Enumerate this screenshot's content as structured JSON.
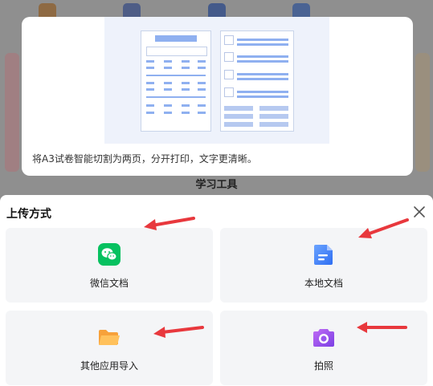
{
  "tip": {
    "description": "将A3试卷智能切割为两页，分开打印，文字更清晰。"
  },
  "background": {
    "section_title": "学习工具"
  },
  "upload_sheet": {
    "title": "上传方式",
    "options": [
      {
        "label": "微信文档",
        "icon": "wechat-icon",
        "color": "#07c160"
      },
      {
        "label": "本地文档",
        "icon": "document-icon",
        "color": "#3b7bf6"
      },
      {
        "label": "其他应用导入",
        "icon": "folder-icon",
        "color": "#f7931e"
      },
      {
        "label": "拍照",
        "icon": "camera-icon",
        "color": "#8e4ff0"
      }
    ]
  },
  "colors": {
    "annotation_arrow": "#e8383d",
    "tile_background": "#f4f5f7",
    "preview_accent": "#8fb0f0"
  }
}
